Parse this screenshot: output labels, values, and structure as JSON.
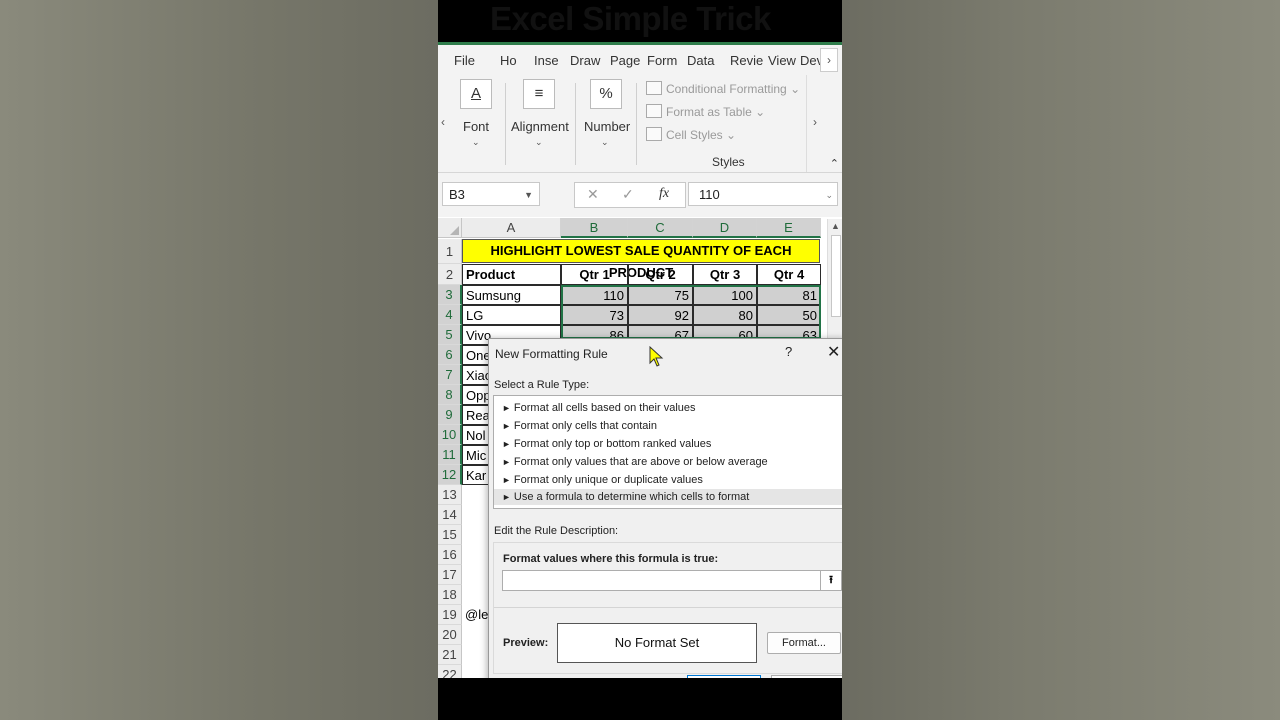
{
  "video_overlay_title": "Excel Simple Trick",
  "ribbon": {
    "tabs": [
      "File",
      "Ho",
      "Inse",
      "Draw",
      "Page",
      "Form",
      "Data",
      "Revie",
      "View",
      "Dev"
    ],
    "groups": [
      {
        "label": "Font",
        "icon_glyph": "A"
      },
      {
        "label": "Alignment",
        "icon_glyph": "≡"
      },
      {
        "label": "Number",
        "icon_glyph": "%"
      }
    ],
    "styles": {
      "items": [
        "Conditional Formatting",
        "Format as Table",
        "Cell Styles"
      ],
      "group_label": "Styles"
    }
  },
  "formula_bar": {
    "name_box": "B3",
    "cancel_glyph": "✕",
    "enter_glyph": "✓",
    "fx_glyph": "fx",
    "value": "110"
  },
  "sheet": {
    "columns": [
      "A",
      "B",
      "C",
      "D",
      "E"
    ],
    "rows": [
      "1",
      "2",
      "3",
      "4",
      "5",
      "6",
      "7",
      "8",
      "9",
      "10",
      "11",
      "12",
      "13",
      "14",
      "15",
      "16",
      "17",
      "18",
      "19",
      "20",
      "21",
      "22"
    ],
    "banner": "HIGHLIGHT LOWEST SALE QUANTITY OF EACH PRODUCT",
    "headers": [
      "Product",
      "Qtr 1",
      "Qtr 2",
      "Qtr 3",
      "Qtr 4"
    ],
    "data": [
      {
        "product": "Sumsung",
        "q": [
          "110",
          "75",
          "100",
          "81"
        ]
      },
      {
        "product": "LG",
        "q": [
          "73",
          "92",
          "80",
          "50"
        ]
      },
      {
        "product": "Vivo",
        "q": [
          "86",
          "67",
          "60",
          "63"
        ]
      }
    ],
    "obscured_names": [
      "One",
      "Xiao",
      "Opp",
      "Rea",
      "Nol",
      "Mic",
      "Kar"
    ],
    "row17_text": "@le"
  },
  "dialog": {
    "title": "New Formatting Rule",
    "help": "?",
    "close": "✕",
    "select_label": "Select a Rule Type:",
    "rules": [
      "Format all cells based on their values",
      "Format only cells that contain",
      "Format only top or bottom ranked values",
      "Format only values that are above or below average",
      "Format only unique or duplicate values",
      "Use a formula to determine which cells to format"
    ],
    "edit_label": "Edit the Rule Description:",
    "formula_label": "Format values where this formula is true:",
    "formula_value": "",
    "preview_label": "Preview:",
    "preview_text": "No Format Set",
    "format_button": "Format..."
  },
  "colors": {
    "excel_green": "#217346",
    "banner_yellow": "#ffff00",
    "selected_cells": "#d0d0d0"
  }
}
